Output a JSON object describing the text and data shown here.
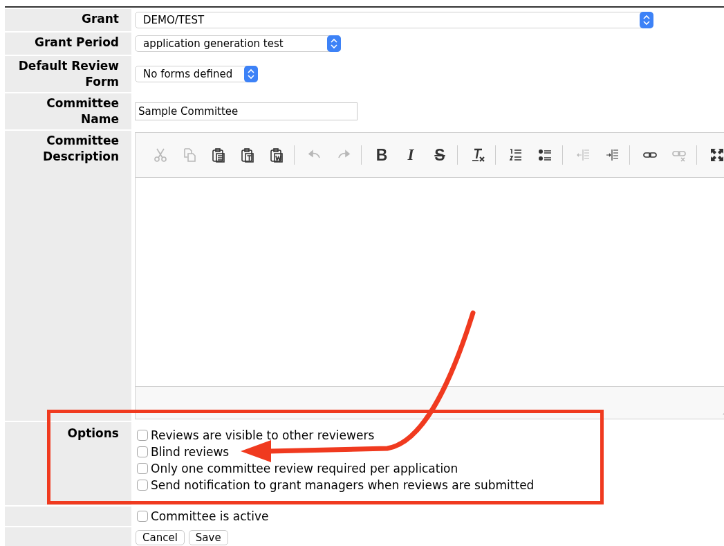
{
  "form": {
    "grant": {
      "label": "Grant",
      "value": "DEMO/TEST"
    },
    "grant_period": {
      "label": "Grant Period",
      "value": "application generation test"
    },
    "default_review_form": {
      "label": "Default Review Form",
      "value": "No forms defined"
    },
    "committee_name": {
      "label": "Committee Name",
      "value": "Sample Committee"
    },
    "committee_description": {
      "label": "Committee Description",
      "toolbar": [
        [
          {
            "kind": "cut",
            "disabled": true
          },
          {
            "kind": "copy",
            "disabled": true
          },
          {
            "kind": "paste",
            "disabled": false
          },
          {
            "kind": "paste-text",
            "disabled": false
          },
          {
            "kind": "paste-word",
            "disabled": false
          }
        ],
        [
          {
            "kind": "undo",
            "disabled": true
          },
          {
            "kind": "redo",
            "disabled": true
          }
        ],
        [
          {
            "kind": "bold",
            "label": "B",
            "disabled": false
          },
          {
            "kind": "italic",
            "label": "I",
            "disabled": false
          },
          {
            "kind": "strike",
            "label": "S",
            "disabled": false
          }
        ],
        [
          {
            "kind": "remove-format",
            "disabled": false
          }
        ],
        [
          {
            "kind": "numbered-list",
            "disabled": false
          },
          {
            "kind": "bulleted-list",
            "disabled": false
          }
        ],
        [
          {
            "kind": "outdent",
            "disabled": true
          },
          {
            "kind": "indent",
            "disabled": false
          }
        ],
        [
          {
            "kind": "link",
            "disabled": false
          },
          {
            "kind": "unlink",
            "disabled": true
          }
        ],
        [
          {
            "kind": "maximize",
            "disabled": false
          }
        ]
      ]
    },
    "options": {
      "label": "Options",
      "items": [
        {
          "label": "Reviews are visible to other reviewers",
          "checked": false
        },
        {
          "label": "Blind reviews",
          "checked": false
        },
        {
          "label": "Only one committee review required per application",
          "checked": false
        },
        {
          "label": "Send notification to grant managers when reviews are submitted",
          "checked": false
        }
      ]
    },
    "active": {
      "label": "Committee is active",
      "checked": false
    },
    "buttons": [
      "Cancel",
      "Save"
    ]
  }
}
